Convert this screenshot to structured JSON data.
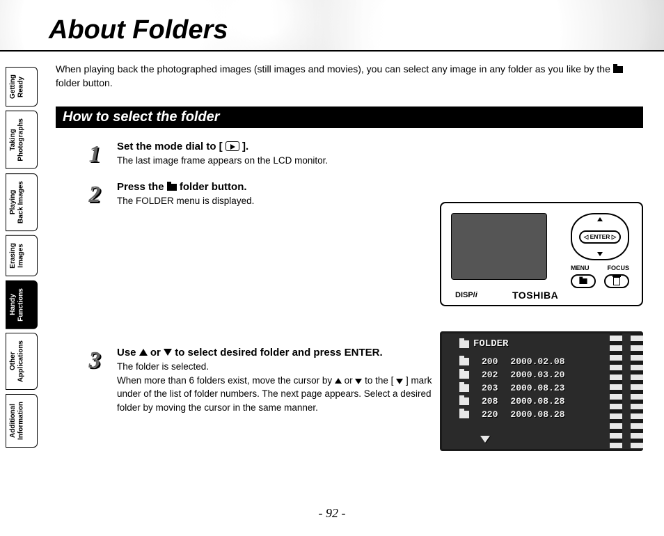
{
  "title": "About Folders",
  "intro_a": "When playing back the photographed images (still images and movies), you can select any image in any folder as you like by the ",
  "intro_b": " folder button.",
  "section_heading": "How to select the folder",
  "tabs": [
    {
      "label": "Getting\nReady",
      "active": false
    },
    {
      "label": "Taking\nPhotographs",
      "active": false
    },
    {
      "label": "Playing\nBack Images",
      "active": false
    },
    {
      "label": "Erasing\nImages",
      "active": false
    },
    {
      "label": "Handy\nFunctions",
      "active": true
    },
    {
      "label": "Other\nApplications",
      "active": false
    },
    {
      "label": "Additional\nInformation",
      "active": false
    }
  ],
  "steps": {
    "s1": {
      "title_a": "Set the mode dial to [ ",
      "title_b": " ].",
      "desc": "The last image frame appears on the LCD monitor."
    },
    "s2": {
      "title_a": "Press the ",
      "title_b": " folder button.",
      "desc": "The FOLDER menu is displayed."
    },
    "s3": {
      "title_a": "Use ",
      "title_b": " or ",
      "title_c": " to select desired folder and press ENTER.",
      "desc_a": "The folder is selected.",
      "desc_b": "When more than 6 folders exist, move the cursor by ",
      "desc_c": " or ",
      "desc_d": " to the [ ",
      "desc_e": " ] mark under of the list of folder numbers. The next page appears. Select a desired folder by moving the cursor in the same manner."
    }
  },
  "camera": {
    "disp": "DISP/",
    "disp_i": "i",
    "brand": "TOSHIBA",
    "enter": "◁ ENTER ▷",
    "menu": "MENU",
    "focus": "FOCUS"
  },
  "folder_menu": {
    "header": "FOLDER",
    "rows": [
      {
        "num": "200",
        "date": "2000.02.08"
      },
      {
        "num": "202",
        "date": "2000.03.20"
      },
      {
        "num": "203",
        "date": "2000.08.23"
      },
      {
        "num": "208",
        "date": "2000.08.28"
      },
      {
        "num": "220",
        "date": "2000.08.28"
      }
    ]
  },
  "page_number": "- 92 -"
}
